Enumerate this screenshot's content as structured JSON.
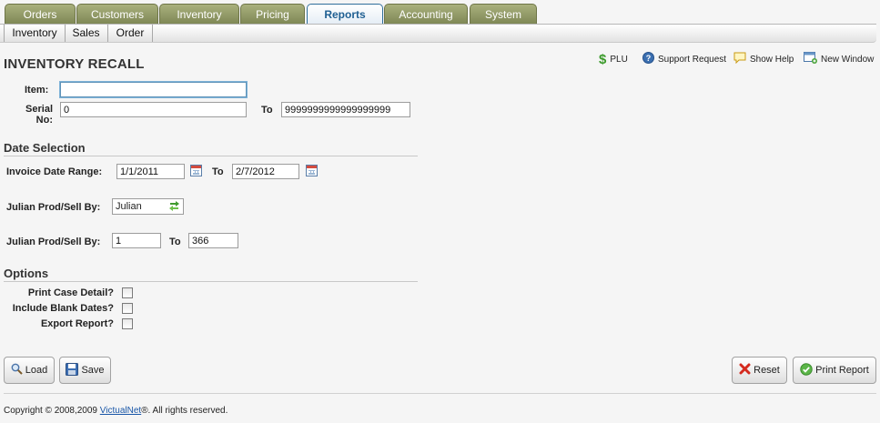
{
  "tabs": [
    {
      "label": "Orders",
      "active": false
    },
    {
      "label": "Customers",
      "active": false
    },
    {
      "label": "Inventory",
      "active": false
    },
    {
      "label": "Pricing",
      "active": false
    },
    {
      "label": "Reports",
      "active": true
    },
    {
      "label": "Accounting",
      "active": false
    },
    {
      "label": "System",
      "active": false
    }
  ],
  "subnav": [
    "Inventory",
    "Sales",
    "Order"
  ],
  "page_title": "INVENTORY RECALL",
  "top_links": {
    "plu": "PLU",
    "support": "Support Request",
    "help": "Show Help",
    "new_window": "New Window"
  },
  "form": {
    "item_label": "Item:",
    "item_value": "",
    "serial_label_1": "Serial",
    "serial_label_2": "No:",
    "serial_from": "0",
    "to_label": "To",
    "serial_to": "9999999999999999999"
  },
  "date_selection": {
    "heading": "Date Selection",
    "invoice_label": "Invoice Date Range:",
    "invoice_from": "1/1/2011",
    "to_label": "To",
    "invoice_to": "2/7/2012",
    "julian_label_1": "Julian Prod/Sell By:",
    "julian_type": "Julian",
    "julian_label_2": "Julian Prod/Sell By:",
    "julian_from": "1",
    "julian_to_label": "To",
    "julian_to": "366"
  },
  "options": {
    "heading": "Options",
    "print_case_detail": "Print Case Detail?",
    "include_blank_dates": "Include Blank Dates?",
    "export_report": "Export Report?",
    "checked": [
      false,
      false,
      false
    ]
  },
  "buttons": {
    "load": "Load",
    "save": "Save",
    "reset": "Reset",
    "print_report": "Print Report"
  },
  "footer": {
    "prefix": "Copyright © 2008,2009 ",
    "brand": "VictualNet",
    "suffix": "®. All rights reserved."
  },
  "colors": {
    "tab_inactive": "#8e9663",
    "tab_active_text": "#1f5f92",
    "link_blue": "#1a57a8"
  }
}
